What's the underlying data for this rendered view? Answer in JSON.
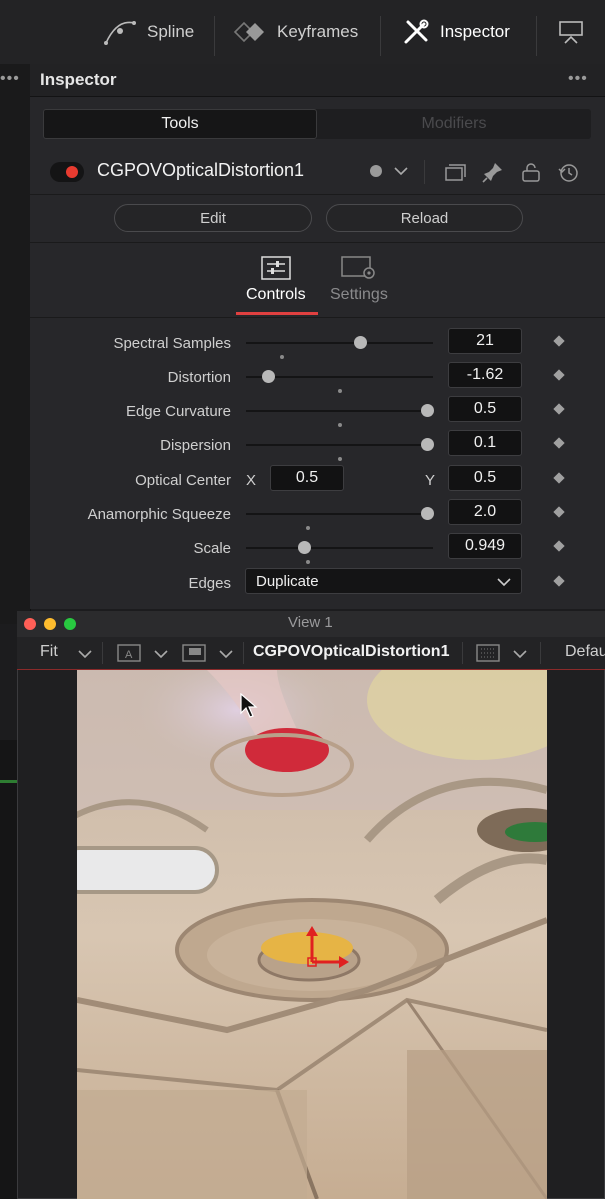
{
  "toolbar": {
    "items": [
      {
        "label": "Spline",
        "icon": "spline-icon"
      },
      {
        "label": "Keyframes",
        "icon": "keyframes-icon"
      },
      {
        "label": "Inspector",
        "icon": "inspector-icon",
        "active": true
      }
    ],
    "extra_icon": "monitor-icon"
  },
  "inspector": {
    "title": "Inspector",
    "tabs": [
      "Tools",
      "Modifiers"
    ],
    "node_name": "CGPOVOpticalDistortion1",
    "buttons": {
      "edit": "Edit",
      "reload": "Reload"
    },
    "subtabs": [
      "Controls",
      "Settings"
    ],
    "controls": [
      {
        "label": "Spectral Samples",
        "value": "21",
        "slider": 0.61,
        "default": 0.19
      },
      {
        "label": "Distortion",
        "value": "-1.62",
        "slider": 0.12,
        "default": 0.5
      },
      {
        "label": "Edge Curvature",
        "value": "0.5",
        "slider": 0.97,
        "default": 0.5
      },
      {
        "label": "Dispersion",
        "value": "0.1",
        "slider": 0.97,
        "default": 0.5
      },
      {
        "label": "Anamorphic Squeeze",
        "value": "2.0",
        "slider": 0.97,
        "default": 0.33
      },
      {
        "label": "Scale",
        "value": "0.949",
        "slider": 0.31,
        "default": 0.33
      }
    ],
    "optical_center": {
      "label": "Optical Center",
      "x_label": "X",
      "x": "0.5",
      "y_label": "Y",
      "y": "0.5"
    },
    "edges": {
      "label": "Edges",
      "value": "Duplicate"
    }
  },
  "viewer": {
    "title": "View 1",
    "fit": "Fit",
    "node": "CGPOVOpticalDistortion1",
    "lut": "Defau",
    "colors": {
      "close": "#ff5f57",
      "min": "#febc2e",
      "max": "#28c840"
    }
  }
}
